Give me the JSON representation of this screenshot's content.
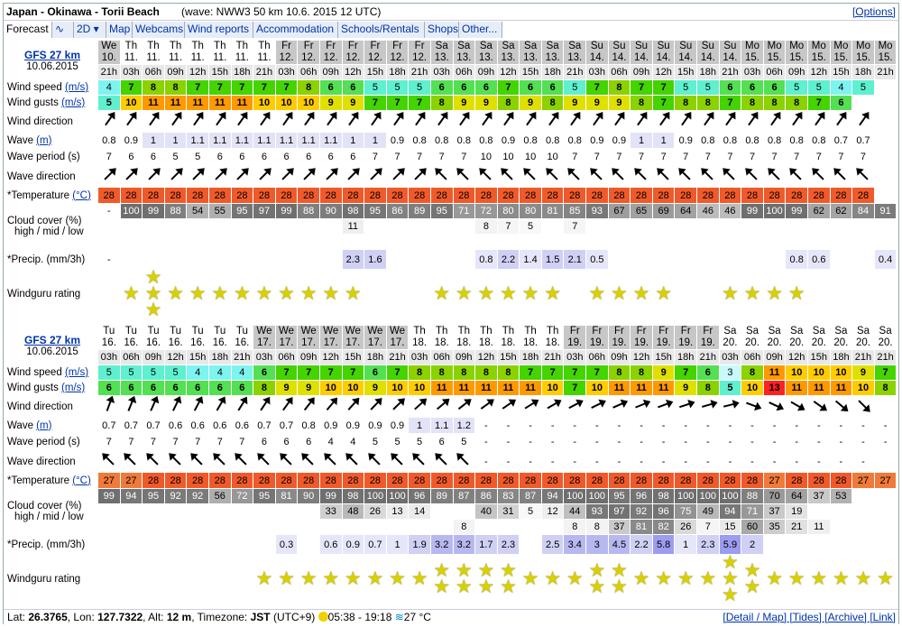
{
  "header": {
    "title": "Japan - Okinawa - Torii Beach",
    "wave": "(wave: NWW3 50 km 10.6. 2015 12 UTC)",
    "options": "[Options]"
  },
  "menu": [
    "Forecast",
    "∿",
    "2D ▾",
    "Map",
    "Webcams",
    "Wind reports",
    "Accommodation",
    "Schools/Rentals",
    "Shops",
    "Other..."
  ],
  "footer": {
    "lat": "26.3765",
    "lon": "127.7322",
    "alt": "12 m",
    "tz": "JST",
    "tz_extra": "(UTC+9)",
    "sun": "05:38 - 19:18",
    "water": "27 °C",
    "links": "[Detail / Map] [Tides] [Archive] [Link]"
  },
  "labels": {
    "model": "GFS 27 km",
    "date": "10.06.2015",
    "utc": "12 UTC",
    "ws": "Wind speed",
    "wg": "Wind gusts",
    "ms": "(m/s)",
    "wdir": "Wind direction",
    "wave": "Wave",
    "m": "(m)",
    "wper": "Wave period (s)",
    "wavedir": "Wave direction",
    "temp": "*Temperature",
    "degc": "(°C)",
    "cloud": "Cloud cover (%)",
    "cloud2": "high / mid / low",
    "precip": "*Precip. (mm/3h)",
    "rating": "Windguru rating"
  },
  "blocks": [
    {
      "days": [
        "We 10.",
        "Th 11.",
        "Th 11.",
        "Th 11.",
        "Th 11.",
        "Th 11.",
        "Th 11.",
        "Th 11.",
        "Fr 12.",
        "Fr 12.",
        "Fr 12.",
        "Fr 12.",
        "Fr 12.",
        "Fr 12.",
        "Fr 12.",
        "Sa 13.",
        "Sa 13.",
        "Sa 13.",
        "Sa 13.",
        "Sa 13.",
        "Sa 13.",
        "Sa 13.",
        "Su 14.",
        "Su 14.",
        "Su 14.",
        "Su 14.",
        "Su 14.",
        "Su 14.",
        "Su 14.",
        "Mo 15.",
        "Mo 15.",
        "Mo 15.",
        "Mo 15.",
        "Mo 15.",
        "Mo 15.",
        "Mo 15."
      ],
      "hours": [
        "21h",
        "03h",
        "06h",
        "09h",
        "12h",
        "15h",
        "18h",
        "21h",
        "03h",
        "06h",
        "09h",
        "12h",
        "15h",
        "18h",
        "21h",
        "03h",
        "06h",
        "09h",
        "12h",
        "15h",
        "18h",
        "21h",
        "03h",
        "06h",
        "09h",
        "12h",
        "15h",
        "18h",
        "21h",
        "03h",
        "06h",
        "09h",
        "12h",
        "15h",
        "18h",
        "21h"
      ],
      "ws": [
        4,
        7,
        8,
        8,
        7,
        7,
        7,
        7,
        7,
        8,
        6,
        6,
        5,
        5,
        5,
        6,
        6,
        6,
        7,
        6,
        6,
        5,
        7,
        8,
        7,
        7,
        5,
        5,
        6,
        6,
        6,
        5,
        5,
        4,
        5
      ],
      "wg": [
        5,
        10,
        11,
        11,
        11,
        11,
        11,
        10,
        10,
        10,
        9,
        9,
        7,
        7,
        7,
        8,
        9,
        9,
        8,
        9,
        8,
        9,
        9,
        9,
        8,
        7,
        8,
        8,
        7,
        8,
        8,
        8,
        7,
        6
      ],
      "wave": [
        "0.8",
        "0.9",
        "1",
        "1",
        "1.1",
        "1.1",
        "1.1",
        "1.1",
        "1.1",
        "1.1",
        "1.1",
        "1",
        "1",
        "0.9",
        "0.8",
        "0.8",
        "0.8",
        "0.8",
        "0.9",
        "0.8",
        "0.8",
        "0.8",
        "0.9",
        "0.9",
        "1",
        "1",
        "0.9",
        "0.8",
        "0.8",
        "0.8",
        "0.8",
        "0.8",
        "0.8",
        "0.7",
        "0.7"
      ],
      "period": [
        "7",
        "6",
        "6",
        "5",
        "5",
        "6",
        "6",
        "6",
        "6",
        "6",
        "6",
        "6",
        "7",
        "7",
        "7",
        "7",
        "7",
        "10",
        "10",
        "10",
        "10",
        "7",
        "7",
        "7",
        "7",
        "7",
        "7",
        "7",
        "7",
        "7",
        "7",
        "7",
        "7",
        "7",
        "7"
      ],
      "temp": [
        28,
        28,
        28,
        28,
        28,
        28,
        28,
        28,
        28,
        28,
        28,
        28,
        28,
        28,
        28,
        28,
        28,
        28,
        28,
        28,
        28,
        28,
        28,
        28,
        28,
        28,
        28,
        28,
        28,
        28,
        28,
        28,
        28,
        28,
        28
      ],
      "high": [
        "-",
        "100",
        "99",
        "88",
        "54",
        "55",
        "95",
        "97",
        "99",
        "88",
        "90",
        "98",
        "95",
        "86",
        "89",
        "95",
        "71",
        "72",
        "80",
        "80",
        "81",
        "85",
        "93",
        "67",
        "65",
        "69",
        "64",
        "46",
        "46",
        "99",
        "100",
        "99",
        "62",
        "62",
        "84",
        "91"
      ],
      "mid": [
        "",
        "",
        "",
        "",
        "",
        "",
        "",
        "",
        "",
        "",
        "",
        "11",
        "",
        "",
        "",
        "",
        "",
        "8",
        "7",
        "5",
        "",
        "7",
        "",
        "",
        "",
        "",
        "",
        "",
        "",
        "",
        "",
        "",
        "",
        "",
        "",
        ""
      ],
      "precip": [
        "-",
        "",
        "",
        "",
        "",
        "",
        "",
        "",
        "",
        "",
        "",
        "2.3",
        "1.6",
        "",
        "",
        "",
        "",
        "0.8",
        "2.2",
        "1.4",
        "1.5",
        "2.1",
        "0.5",
        "",
        "",
        "",
        "",
        "",
        "",
        "",
        "",
        "0.8",
        "0.6",
        "",
        "",
        "0.4"
      ],
      "rating": [
        0,
        1,
        3,
        1,
        1,
        1,
        1,
        1,
        1,
        1,
        1,
        1,
        0,
        0,
        0,
        1,
        1,
        1,
        1,
        1,
        1,
        0,
        1,
        1,
        1,
        1,
        0,
        0,
        1,
        1,
        1,
        1,
        0,
        0,
        0,
        0
      ]
    },
    {
      "days": [
        "Tu 16.",
        "Tu 16.",
        "Tu 16.",
        "Tu 16.",
        "Tu 16.",
        "Tu 16.",
        "Tu 16.",
        "We 17.",
        "We 17.",
        "We 17.",
        "We 17.",
        "We 17.",
        "We 17.",
        "We 17.",
        "Th 18.",
        "Th 18.",
        "Th 18.",
        "Th 18.",
        "Th 18.",
        "Th 18.",
        "Th 18.",
        "Fr 19.",
        "Fr 19.",
        "Fr 19.",
        "Fr 19.",
        "Fr 19.",
        "Fr 19.",
        "Fr 19.",
        "Sa 20.",
        "Sa 20.",
        "Sa 20.",
        "Sa 20.",
        "Sa 20.",
        "Sa 20.",
        "Sa 20.",
        "Sa 20."
      ],
      "hours": [
        "03h",
        "06h",
        "09h",
        "12h",
        "15h",
        "18h",
        "21h",
        "03h",
        "06h",
        "09h",
        "12h",
        "15h",
        "18h",
        "21h",
        "03h",
        "06h",
        "09h",
        "12h",
        "15h",
        "18h",
        "21h",
        "03h",
        "06h",
        "09h",
        "12h",
        "15h",
        "18h",
        "21h",
        "03h",
        "06h",
        "09h",
        "12h",
        "15h",
        "18h",
        "21h",
        "21h"
      ],
      "ws": [
        5,
        5,
        5,
        5,
        4,
        4,
        4,
        6,
        7,
        7,
        7,
        7,
        6,
        7,
        8,
        8,
        8,
        8,
        8,
        7,
        7,
        7,
        7,
        8,
        8,
        9,
        7,
        6,
        3,
        8,
        11,
        10,
        10,
        10,
        9,
        7
      ],
      "wg": [
        6,
        6,
        6,
        6,
        6,
        6,
        6,
        8,
        9,
        9,
        10,
        10,
        9,
        10,
        10,
        11,
        11,
        11,
        11,
        11,
        10,
        7,
        10,
        11,
        11,
        11,
        9,
        8,
        5,
        10,
        13,
        11,
        11,
        11,
        10,
        8
      ],
      "wave": [
        "0.7",
        "0.7",
        "0.7",
        "0.6",
        "0.6",
        "0.6",
        "0.6",
        "0.7",
        "0.7",
        "0.8",
        "0.9",
        "0.9",
        "0.9",
        "0.9",
        "1",
        "1.1",
        "1.2",
        "-",
        "-",
        "-",
        "-",
        "-",
        "-",
        "-",
        "-",
        "-",
        "-",
        "-",
        "-",
        "-",
        "-",
        "-",
        "-",
        "-",
        "-",
        "-"
      ],
      "period": [
        "7",
        "7",
        "7",
        "7",
        "7",
        "7",
        "7",
        "6",
        "6",
        "6",
        "4",
        "4",
        "5",
        "5",
        "5",
        "6",
        "5",
        "-",
        "-",
        "-",
        "-",
        "-",
        "-",
        "-",
        "-",
        "-",
        "-",
        "-",
        "-",
        "-",
        "-",
        "-",
        "-",
        "-",
        "-",
        "-"
      ],
      "temp": [
        27,
        27,
        28,
        28,
        28,
        28,
        28,
        28,
        28,
        28,
        28,
        28,
        28,
        28,
        28,
        28,
        28,
        28,
        28,
        28,
        28,
        28,
        28,
        28,
        28,
        28,
        28,
        28,
        28,
        28,
        27,
        28,
        28,
        28,
        27,
        27
      ],
      "high": [
        "99",
        "94",
        "95",
        "92",
        "92",
        "56",
        "72",
        "95",
        "81",
        "90",
        "99",
        "98",
        "100",
        "100",
        "96",
        "89",
        "87",
        "86",
        "83",
        "87",
        "94",
        "100",
        "100",
        "95",
        "96",
        "98",
        "100",
        "100",
        "100",
        "88",
        "70",
        "64",
        "37",
        "53",
        "",
        ""
      ],
      "mid": [
        "",
        "",
        "",
        "",
        "",
        "",
        "",
        "",
        "",
        "",
        "33",
        "48",
        "26",
        "13",
        "14",
        "",
        "",
        "40",
        "31",
        "5",
        "12",
        "44",
        "93",
        "97",
        "92",
        "96",
        "75",
        "49",
        "94",
        "71",
        "37",
        "19",
        "",
        "",
        "",
        ""
      ],
      "low": [
        "",
        "",
        "",
        "",
        "",
        "",
        "",
        "",
        "",
        "",
        "",
        "",
        "",
        "",
        "",
        "",
        "8",
        "",
        "",
        "",
        "",
        "8",
        "8",
        "37",
        "81",
        "82",
        "26",
        "7",
        "15",
        "60",
        "35",
        "21",
        "11",
        "",
        "",
        ""
      ],
      "precip": [
        "",
        "",
        "",
        "",
        "",
        "",
        "",
        "",
        "0.3",
        "",
        "0.6",
        "0.9",
        "0.7",
        "1",
        "1.9",
        "3.2",
        "3.2",
        "1.7",
        "2.3",
        "",
        "2.5",
        "3.4",
        "3",
        "4.5",
        "2.2",
        "5.8",
        "1",
        "2.3",
        "5.9",
        "2",
        "",
        "",
        "",
        "",
        "",
        ""
      ],
      "rating": [
        0,
        0,
        0,
        0,
        0,
        0,
        0,
        1,
        1,
        1,
        1,
        1,
        1,
        1,
        1,
        2,
        2,
        2,
        2,
        1,
        1,
        1,
        2,
        2,
        1,
        1,
        1,
        1,
        3,
        2,
        1,
        1,
        1,
        1,
        1,
        1
      ]
    }
  ],
  "colors": {
    "accent": "#0033aa",
    "temp": "#f05a2a"
  }
}
